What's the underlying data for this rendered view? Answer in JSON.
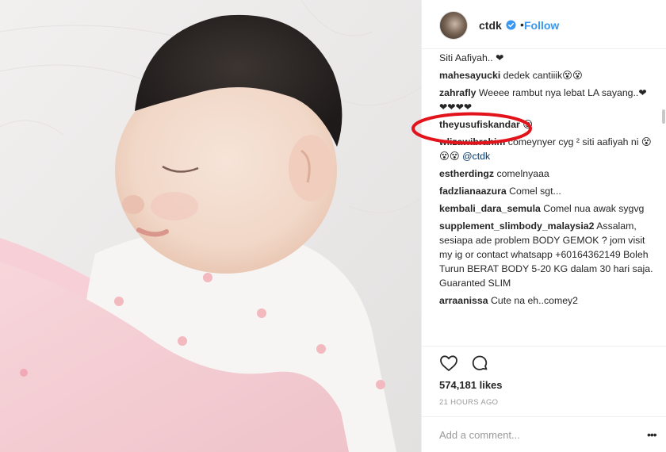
{
  "header": {
    "username": "ctdk",
    "dot": "•",
    "follow_label": "Follow"
  },
  "comments": {
    "first_line": "Siti Aafiyah.. ❤",
    "items": [
      {
        "user": "mahesayucki",
        "text": "dedek cantiiik😵😵"
      },
      {
        "user": "zahrafly",
        "text": "Weeee rambut nya lebat LA sayang..❤❤❤❤❤"
      },
      {
        "user": "theyusufiskandar",
        "text": "😌"
      },
      {
        "user": "wlizawibrahim",
        "text": "comeynyer cyg ² siti aafiyah ni 😵😵😵",
        "mention": "@ctdk"
      },
      {
        "user": "estherdingz",
        "text": "comelnyaaa"
      },
      {
        "user": "fadzlianaazura",
        "text": "Comel sgt..."
      },
      {
        "user": "kembali_dara_semula",
        "text": "Comel nua awak sygvg"
      },
      {
        "user": "supplement_slimbody_malaysia2",
        "text": "Assalam, sesiapa ade problem BODY GEMOK ? jom visit my ig or contact whatsapp +60164362149 Boleh Turun BERAT BODY 5-20 KG dalam 30 hari saja. Guaranted SLIM"
      },
      {
        "user": "arraanissa",
        "text": "Cute na eh..comey2"
      }
    ]
  },
  "actions": {
    "like_icon": "heart-outline-icon",
    "comment_icon": "speech-bubble-icon",
    "likes": "574,181 likes",
    "time_ago": "21 HOURS AGO"
  },
  "add_comment": {
    "placeholder": "Add a comment...",
    "more_label": "•••"
  },
  "colors": {
    "link_blue": "#3897f0",
    "annotation_red": "#e2131b",
    "text_dark": "#262626",
    "text_muted": "#999999"
  }
}
